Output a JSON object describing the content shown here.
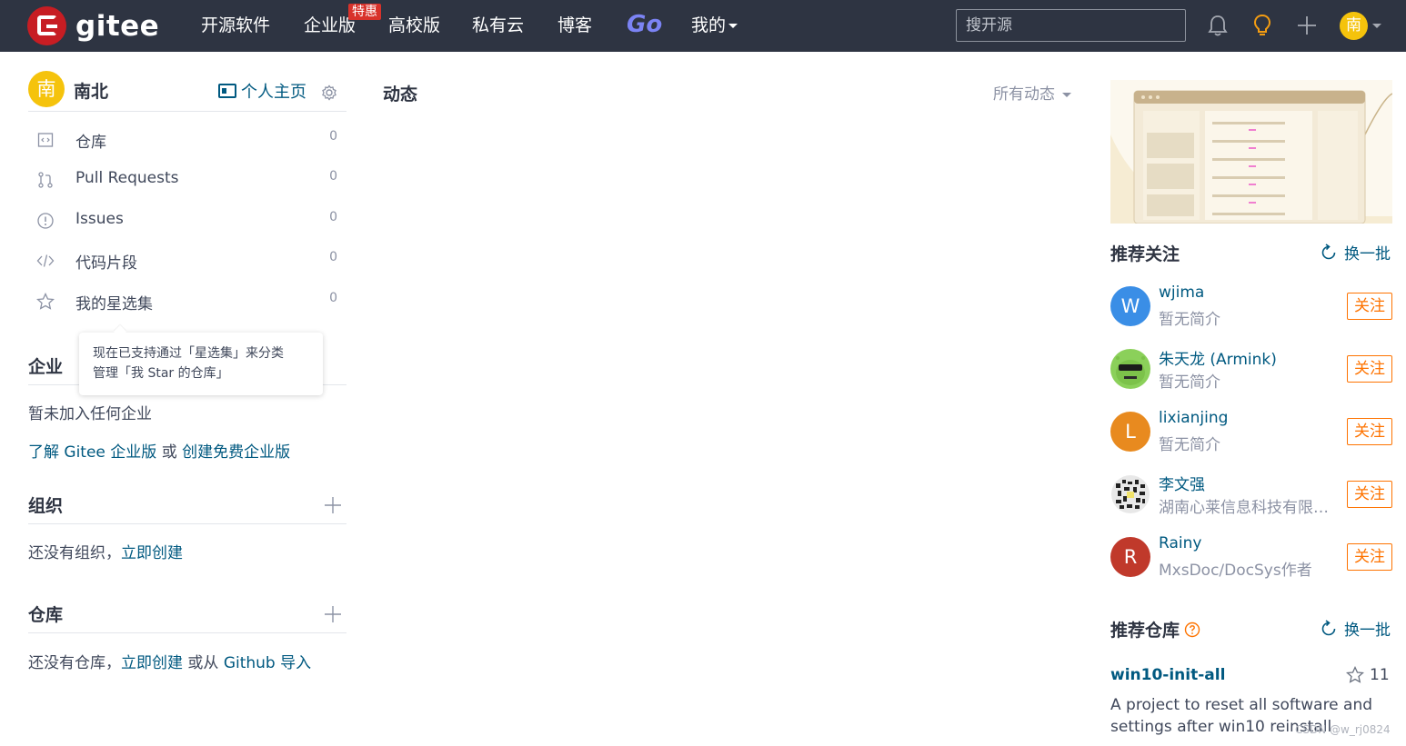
{
  "navbar": {
    "logo_text": "gitee",
    "items": [
      "开源软件",
      "企业版",
      "高校版",
      "私有云",
      "博客"
    ],
    "badge": "特惠",
    "go_label": "Go",
    "mine_label": "我的",
    "search_placeholder": "搜开源",
    "avatar_char": "南"
  },
  "user": {
    "avatar_char": "南",
    "name": "南北",
    "home_label": "个人主页"
  },
  "menu": [
    {
      "label": "仓库",
      "count": "0",
      "icon": "repo-icon"
    },
    {
      "label": "Pull Requests",
      "count": "0",
      "icon": "pull-request-icon"
    },
    {
      "label": "Issues",
      "count": "0",
      "icon": "issue-icon"
    },
    {
      "label": "代码片段",
      "count": "0",
      "icon": "code-icon"
    },
    {
      "label": "我的星选集",
      "count": "0",
      "icon": "star-icon"
    }
  ],
  "tooltip": {
    "line1": "现在已支持通过「星选集」来分类",
    "line2": "管理「我 Star 的仓库」"
  },
  "enterprise": {
    "title": "企业",
    "empty": "暂未加入任何企业",
    "link1": "了解 Gitee 企业版",
    "or": "或",
    "link2": "创建免费企业版"
  },
  "org": {
    "title": "组织",
    "text": "还没有组织，",
    "link": "立即创建"
  },
  "repos": {
    "title": "仓库",
    "text": "还没有仓库，",
    "link1": "立即创建",
    "or": "或从",
    "link2": "Github 导入"
  },
  "feed": {
    "title": "动态",
    "filter": "所有动态"
  },
  "recommend_users": {
    "title": "推荐关注",
    "refresh": "换一批",
    "follow_label": "关注",
    "items": [
      {
        "name": "wjima",
        "desc": "暂无简介",
        "avatar": "W",
        "color": "#3a8ee6"
      },
      {
        "name": "朱天龙 (Armink)",
        "desc": "暂无简介",
        "avatar": "",
        "color": "#8bd05a"
      },
      {
        "name": "lixianjing",
        "desc": "暂无简介",
        "avatar": "L",
        "color": "#e88a1f"
      },
      {
        "name": "李文强",
        "desc": "湖南心莱信息科技有限公司",
        "avatar": "",
        "color": "#333333"
      },
      {
        "name": "Rainy",
        "desc": "MxsDoc/DocSys作者",
        "avatar": "R",
        "color": "#c0392b"
      }
    ]
  },
  "recommend_repos": {
    "title": "推荐仓库",
    "refresh": "换一批",
    "repo_name": "win10-init-all",
    "stars": "11",
    "repo_desc": "A project to reset all software and settings after win10 reinstall"
  },
  "watermark": "CSDN @w_rj0824"
}
